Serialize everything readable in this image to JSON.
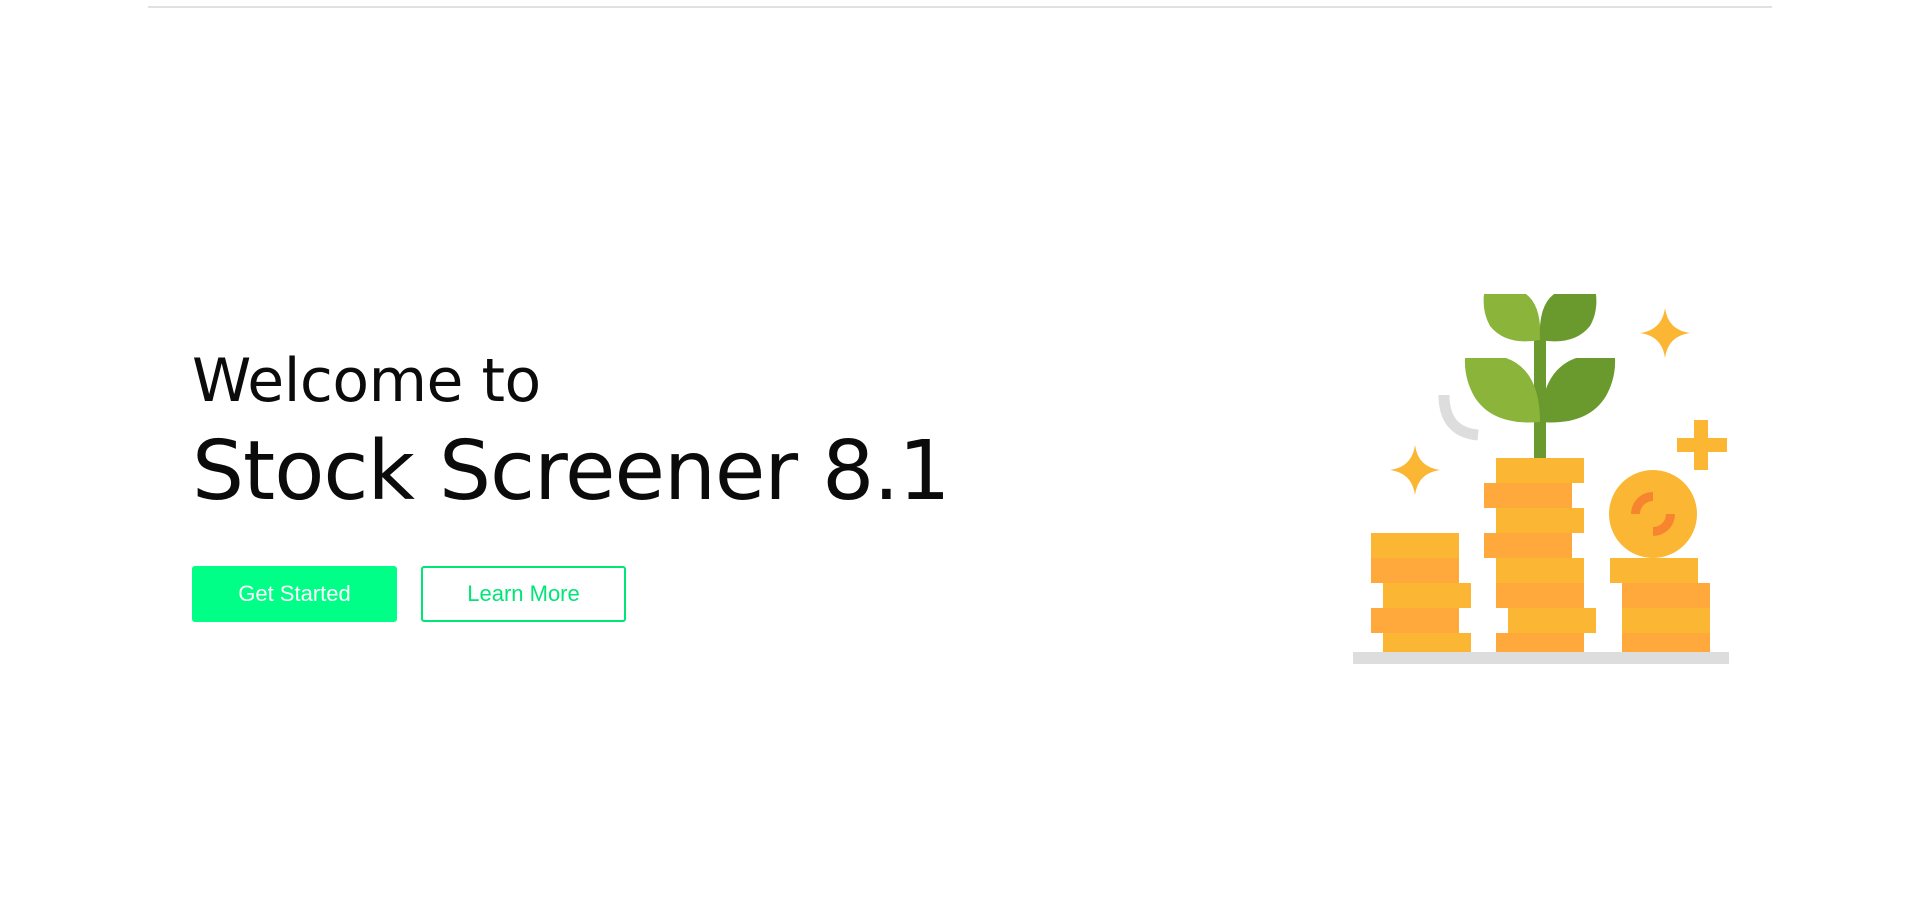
{
  "hero": {
    "welcome": "Welcome to",
    "title": "Stock Screener 8.1"
  },
  "actions": {
    "primary_label": "Get Started",
    "secondary_label": "Learn More"
  },
  "colors": {
    "accent": "#00ff86",
    "accent_border": "#00e676",
    "coin_light": "#fbb634",
    "coin_dark": "#ffa83b",
    "leaf_light": "#8ab43a",
    "leaf_dark": "#6a9a2e",
    "shelf": "#dddddd"
  },
  "illustration": {
    "icon": "coin-stacks-with-sprout-icon"
  }
}
